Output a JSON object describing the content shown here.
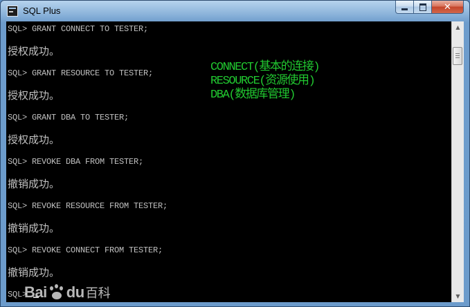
{
  "window": {
    "title": "SQL Plus",
    "minimize_icon": "minimize-icon",
    "maximize_icon": "maximize-icon",
    "close_label": "✕"
  },
  "console": {
    "lines": [
      {
        "kind": "cmd",
        "text": "SQL> GRANT CONNECT TO TESTER;"
      },
      {
        "kind": "msg",
        "text": "授权成功。"
      },
      {
        "kind": "cmd",
        "text": "SQL> GRANT RESOURCE TO TESTER;"
      },
      {
        "kind": "msg",
        "text": "授权成功。"
      },
      {
        "kind": "cmd",
        "text": "SQL> GRANT DBA TO TESTER;"
      },
      {
        "kind": "msg",
        "text": "授权成功。"
      },
      {
        "kind": "cmd",
        "text": "SQL> REVOKE DBA FROM TESTER;"
      },
      {
        "kind": "msg",
        "text": "撤销成功。"
      },
      {
        "kind": "cmd",
        "text": "SQL> REVOKE RESOURCE FROM TESTER;"
      },
      {
        "kind": "msg",
        "text": "撤销成功。"
      },
      {
        "kind": "cmd",
        "text": "SQL> REVOKE CONNECT FROM TESTER;"
      },
      {
        "kind": "msg",
        "text": "撤销成功。"
      },
      {
        "kind": "cmd",
        "text": "SQL> "
      }
    ],
    "annotations": [
      "CONNECT(基本的连接)",
      "RESOURCE(资源使用)",
      "DBA(数据库管理)"
    ],
    "text_color": "#c0c0c0",
    "annotation_color": "#21c830",
    "background": "#000000"
  },
  "watermark": {
    "latin_left": "Bai",
    "latin_right": "du",
    "chinese": "百科"
  },
  "scrollbar": {
    "up_icon": "scroll-up-arrow-icon",
    "down_icon": "scroll-down-arrow-icon"
  }
}
